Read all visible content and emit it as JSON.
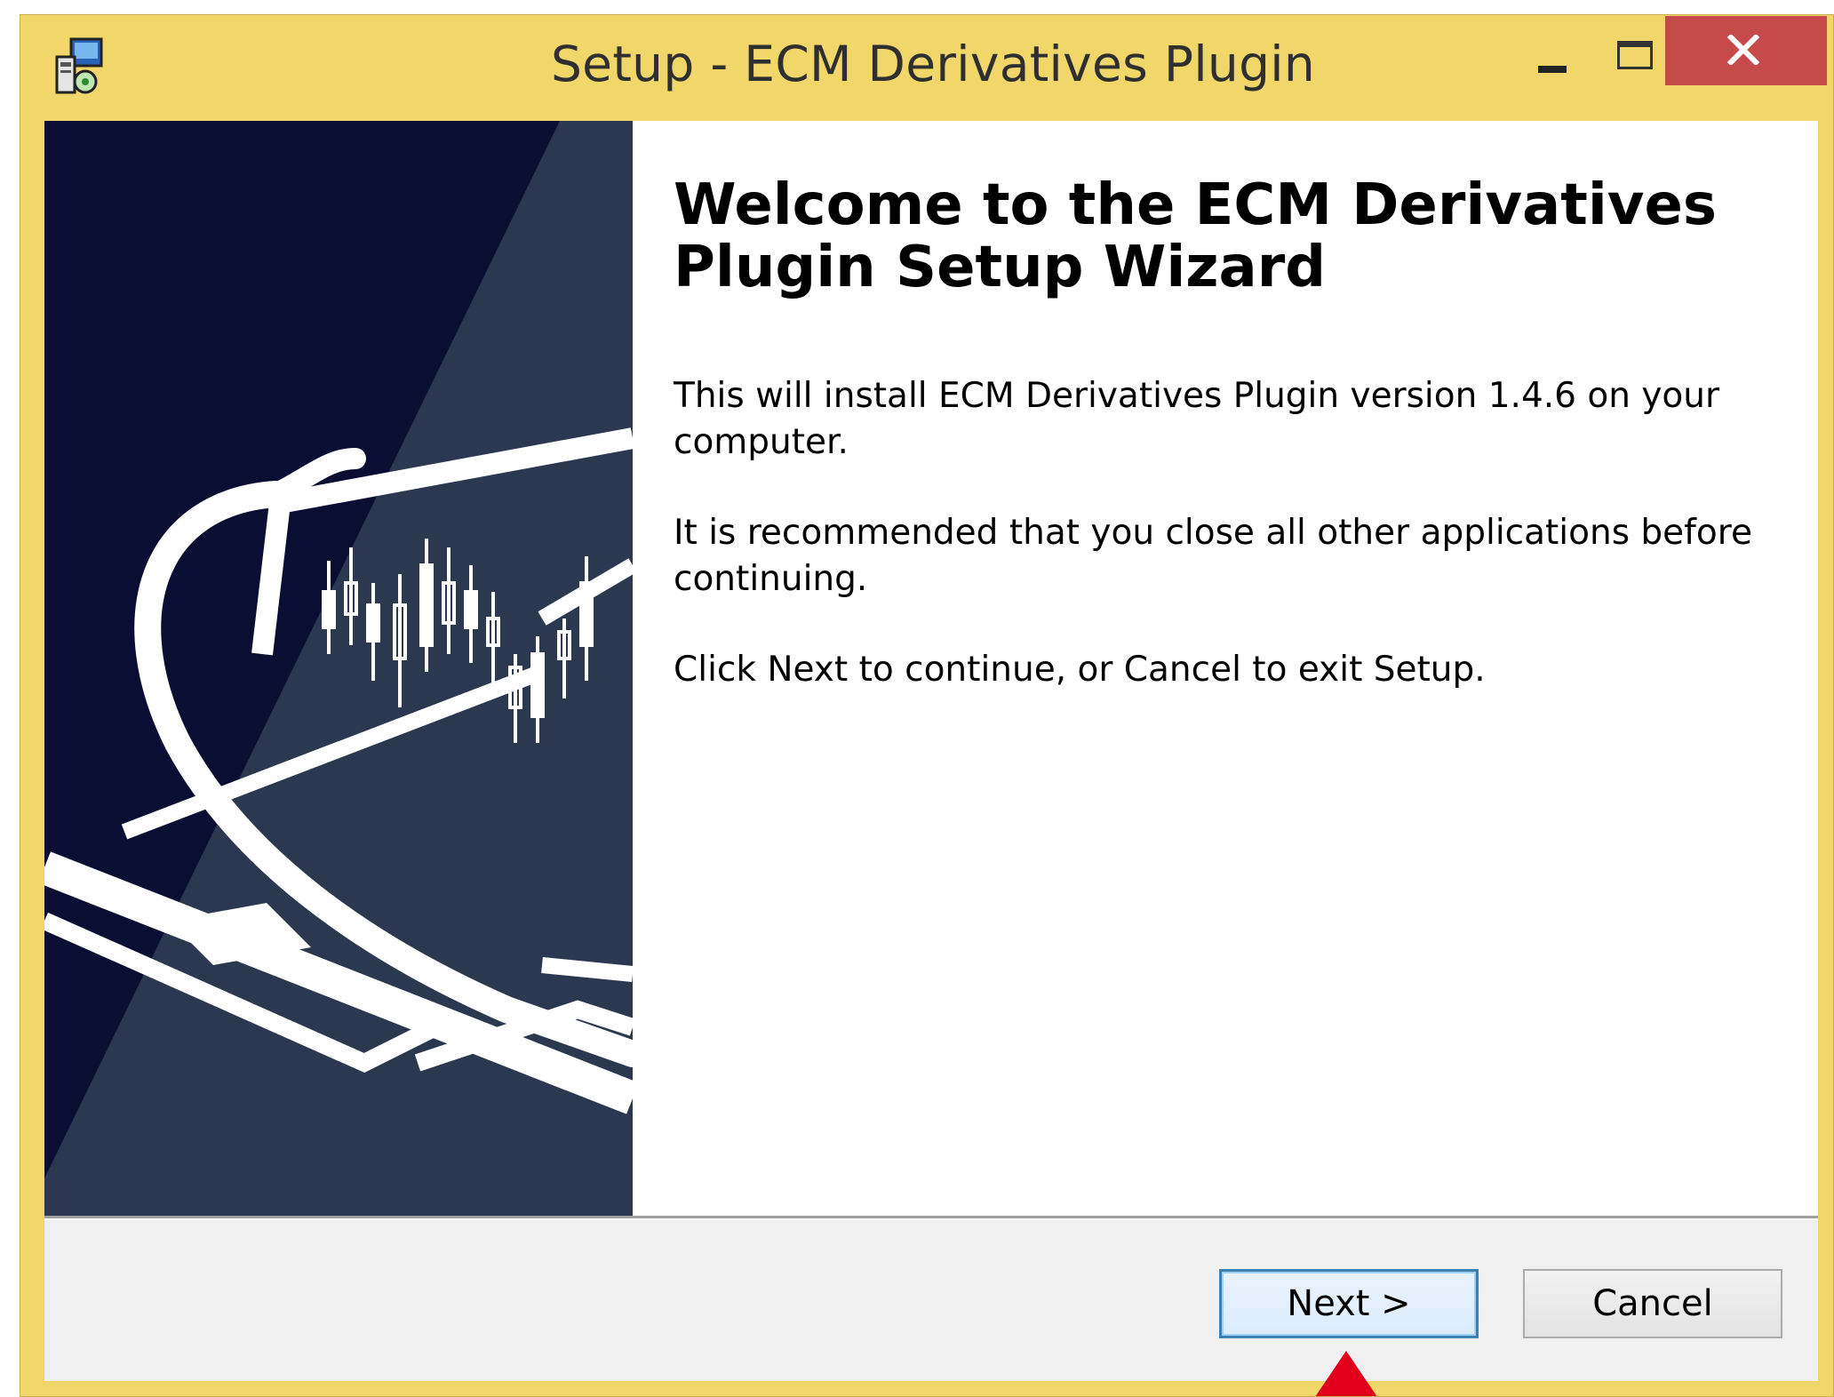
{
  "window": {
    "title": "Setup - ECM Derivatives Plugin",
    "controls": {
      "minimize": "minimize",
      "maximize": "maximize",
      "close": "close"
    }
  },
  "welcome": {
    "heading": "Welcome to the ECM Derivatives Plugin Setup Wizard",
    "paragraphs": [
      "This will install ECM Derivatives Plugin version 1.4.6 on your computer.",
      "It is recommended that you close all other applications before continuing.",
      "Click Next to continue, or Cancel to exit Setup."
    ]
  },
  "buttons": {
    "next": "Next >",
    "cancel": "Cancel"
  },
  "colors": {
    "frame": "#f1d66a",
    "close_button": "#c74a4a",
    "panel_dark": "#0b0e33",
    "panel_slate": "#2b3850",
    "next_border": "#3c7fb1",
    "pointer": "#e0001b"
  },
  "icons": [
    "setup-app-icon",
    "minimize-icon",
    "maximize-icon",
    "close-icon",
    "pointer-arrow-icon"
  ]
}
